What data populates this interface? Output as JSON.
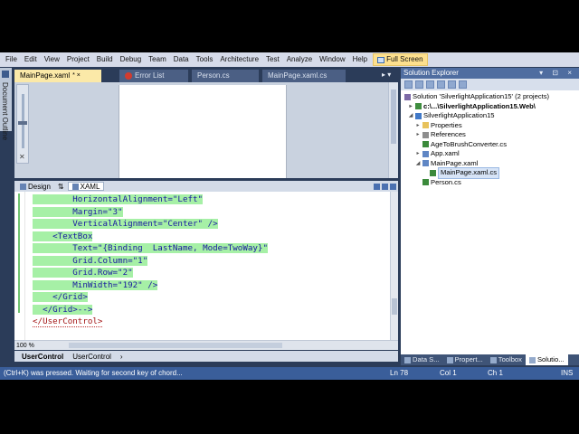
{
  "menu": [
    "File",
    "Edit",
    "View",
    "Project",
    "Build",
    "Debug",
    "Team",
    "Data",
    "Tools",
    "Architecture",
    "Test",
    "Analyze",
    "Window",
    "Help"
  ],
  "full_screen_label": "Full Screen",
  "doc_outline_label": "Document Outline",
  "tabs": {
    "mainpage_xaml": "MainPage.xaml",
    "mainpage_xaml_marks": "* ×",
    "error_list": "Error List",
    "person_cs": "Person.cs",
    "mainpage_xaml_cs": "MainPage.xaml.cs",
    "nav": "▸ ▾"
  },
  "split": {
    "design": "Design",
    "xaml": "XAML",
    "swap": "⇅"
  },
  "code": {
    "l1": "        HorizontalAlignment=\"Left\"",
    "l2": "        Margin=\"3\"",
    "l3": "        VerticalAlignment=\"Center\" />",
    "l4": "    <TextBox",
    "l5": "        Text=\"{Binding  LastName, Mode=TwoWay}\"",
    "l6": "        Grid.Column=\"1\"",
    "l7": "        Grid.Row=\"2\"",
    "l8": "        MinWidth=\"192\" />",
    "l9": "    </Grid>",
    "l10": "  </Grid>-->",
    "l11": "</UserControl>"
  },
  "zoom": "100 %",
  "breadcrumb": {
    "first": "UserControl",
    "second": "UserControl",
    "arrow": "›"
  },
  "solution_explorer": {
    "title": "Solution Explorer",
    "buttons": "▾ ⊡ ×",
    "nodes": {
      "solution": "Solution 'SilverlightApplication15' (2 projects)",
      "web": "c:\\...\\SilverlightApplication15.Web\\",
      "project": "SilverlightApplication15",
      "properties": "Properties",
      "references": "References",
      "converter": "AgeToBrushConverter.cs",
      "app": "App.xaml",
      "mainpage": "MainPage.xaml",
      "mainpage_cs": "MainPage.xaml.cs",
      "person": "Person.cs"
    }
  },
  "tool_tabs": [
    "Data S...",
    "Propert...",
    "Toolbox",
    "Solutio..."
  ],
  "status": {
    "message": "(Ctrl+K) was pressed. Waiting for second key of chord...",
    "ln": "Ln 78",
    "col": "Col 1",
    "ch": "Ch 1",
    "mode": "INS"
  }
}
